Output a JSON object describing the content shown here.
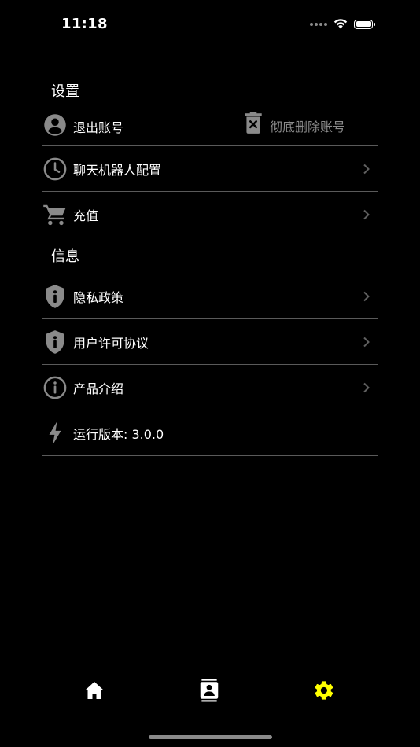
{
  "status_bar": {
    "time": "11:18"
  },
  "settings_section": {
    "title": "设置",
    "logout_label": "退出账号",
    "delete_account_label": "彻底删除账号",
    "chatbot_config_label": "聊天机器人配置",
    "recharge_label": "充值"
  },
  "info_section": {
    "title": "信息",
    "privacy_policy_label": "隐私政策",
    "user_license_label": "用户许可协议",
    "product_intro_label": "产品介绍",
    "version_label": "运行版本: 3.0.0"
  },
  "tab_bar": {
    "active_tab": "settings",
    "active_color": "#FFFF00",
    "inactive_color": "#FFFFFF"
  },
  "colors": {
    "background": "#000000",
    "divider": "#5A5A5A",
    "icon_gray": "#8A8A8A",
    "muted_text": "#8A8A8A"
  }
}
